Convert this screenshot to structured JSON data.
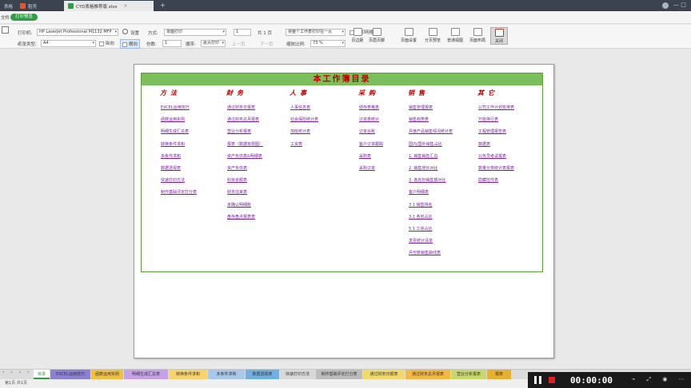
{
  "titlebar": {
    "tabs": [
      {
        "label": "表格",
        "icon": "home-icon"
      },
      {
        "label": "稻壳",
        "icon": "docer-icon"
      },
      {
        "label": "CYD表格推荐版.xlsx",
        "icon": "spreadsheet-icon"
      }
    ],
    "add_tab": "+"
  },
  "menu": {
    "item": "文件",
    "active_mode": "打印预览"
  },
  "ribbon": {
    "printer_label": "打印机:",
    "printer_value": "HP LaserJet Professional M1132 MFP",
    "settings_label": "设置",
    "method_label": "方式:",
    "method_value": "单面打印",
    "pages_value": "1",
    "pages_total": "共 1 页",
    "scope_value": "将整个工作表打印在一页",
    "print_grid_label": "打印网格线",
    "paper_label": "纸张类型:",
    "paper_value": "A4",
    "portrait_label": "纵向",
    "landscape_label": "横向",
    "copies_label": "份数:",
    "copies_value": "1",
    "order_label": "顺序:",
    "order_value": "逐页打印",
    "prev_page": "上一页",
    "next_page": "下一页",
    "zoom_label": "缩放比例:",
    "zoom_value": "73 %",
    "buttons": [
      "页边距",
      "页眉页脚",
      "页面设置",
      "分页预览",
      "普通视图",
      "页面布局",
      "关闭"
    ]
  },
  "sheet": {
    "title": "本工作簿目录",
    "columns": [
      {
        "heading": "方法",
        "links": [
          "EXCEL运用技巧",
          "函数运用实例",
          "明细生成汇总表",
          "转换条件求和",
          "多条件求和",
          "数据透视表",
          "快速打印方法",
          "制作基础评定打分表"
        ]
      },
      {
        "heading": "财务",
        "links": [
          "通过财务日报表",
          "通过财务总月报表",
          "营业分析报表",
          "报表（数据有限图）",
          "资产负债表&明细表",
          "资产负债表",
          "科目余额表",
          "财务往来表",
          "未确认明细账",
          "盘存盘点报表表"
        ]
      },
      {
        "heading": "人事",
        "links": [
          "人事信息表",
          "社会保险统计表",
          "加班统计表",
          "工资表"
        ]
      },
      {
        "heading": "采购",
        "links": [
          "结存表格表",
          "订单表统计",
          "订单台账",
          "客户订单跟踪",
          "采购表",
          "采购订单"
        ]
      },
      {
        "heading": "销售",
        "links": [
          "销售管理报表",
          "销售趋势表",
          "月度产品销售情况统计表",
          "国内/国外销售占比",
          "1. 销售销售汇总",
          "2. 销售增长对比",
          "3. 各省份销售额对比",
          "客户明细表",
          "3.1 销售排名",
          "3.1 各省占比",
          "5.1 工资占比",
          "发票统计清单",
          "月份数销售曲线表"
        ]
      },
      {
        "heading": "其它",
        "links": [
          "公司工作计划安排表",
          "万能排行表",
          "工程管理报告表",
          "数据表",
          "公务员考试报表",
          "数量分类统计表报表",
          "隐藏控件表"
        ]
      }
    ]
  },
  "sheet_tabs": [
    "目录",
    "EXCEL运用技巧",
    "函数运用实例",
    "明细生成汇总表",
    "转换条件求和",
    "多条件求和",
    "数据透视表",
    "快速打印方法",
    "制作基础评定打分表",
    "通过财务日报表",
    "通过财务总月报表",
    "营业分析报表",
    "报表"
  ],
  "status": {
    "page_info": "第1页 共1页"
  },
  "video": {
    "time": "00:00:00"
  }
}
